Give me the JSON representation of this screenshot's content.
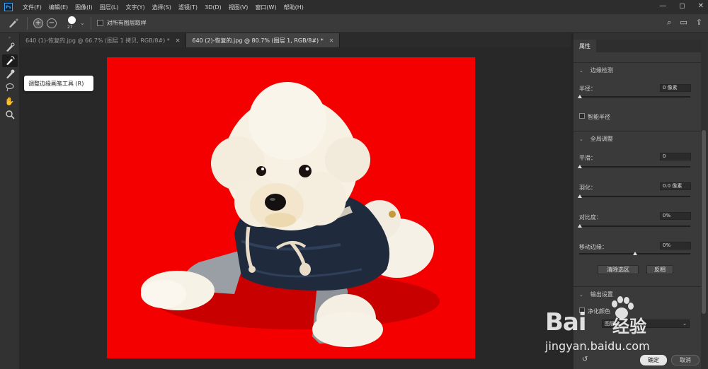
{
  "menubar": {
    "logo": "Ps",
    "items": [
      "文件(F)",
      "编辑(E)",
      "图像(I)",
      "图层(L)",
      "文字(Y)",
      "选择(S)",
      "滤镜(T)",
      "3D(D)",
      "视图(V)",
      "窗口(W)",
      "帮助(H)"
    ],
    "window_controls": [
      "—",
      "◻",
      "✕"
    ]
  },
  "options": {
    "brush_size": "27",
    "sample_all_layers_label": "对所有图层取样",
    "sample_all_layers_checked": false
  },
  "tooltip": "调整边缘画笔工具 (R)",
  "tabs": [
    {
      "label": "640 (1)-恢复的.jpg @ 66.7% (图层 1 拷贝, RGB/8#) *",
      "close": "✕",
      "active": false
    },
    {
      "label": "640 (2)-恢复的.jpg @ 80.7% (图层 1, RGB/8#) *",
      "close": "✕",
      "active": true
    }
  ],
  "panel": {
    "tab": "属性",
    "edge_detection": {
      "title": "边缘检测",
      "radius_label": "半径：",
      "radius_value": "0 像素",
      "smart_radius_label": "智能半径",
      "smart_radius_checked": false
    },
    "global": {
      "title": "全局调整",
      "smooth_label": "平滑：",
      "smooth_value": "0",
      "feather_label": "羽化：",
      "feather_value": "0.0 像素",
      "contrast_label": "对比度：",
      "contrast_value": "0%",
      "shift_edge_label": "移动边缘：",
      "shift_edge_value": "0%",
      "shift_edge_level": 0.5,
      "clear_selection": "清除选区",
      "invert": "反相"
    },
    "output": {
      "title": "输出设置",
      "decontaminate_label": "净化颜色",
      "output_to_value": "图层"
    },
    "ok": "确定",
    "cancel": "取消"
  },
  "watermark": {
    "logo": "Bai",
    "text": "经验",
    "url": "jingyan.baidu.com"
  },
  "colors": {
    "canvas_bg": "#f40000",
    "accent": "#31a8ff"
  }
}
